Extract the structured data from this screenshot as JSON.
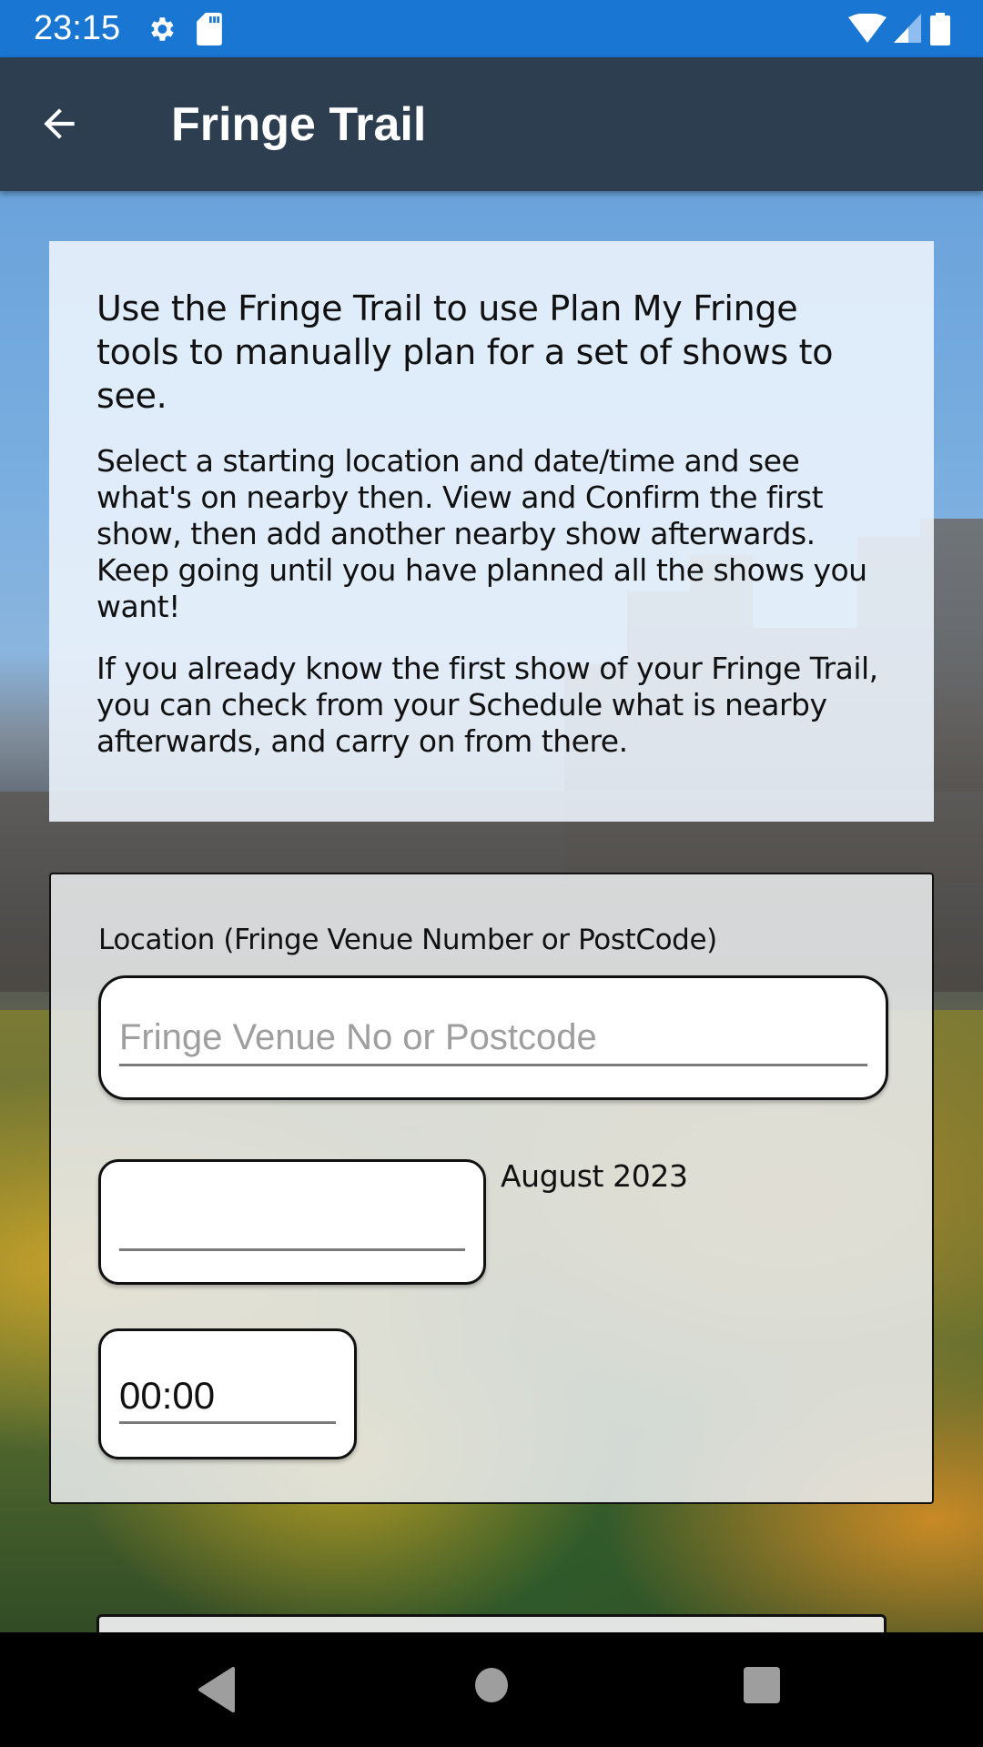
{
  "status_bar": {
    "time": "23:15",
    "left_icons": [
      "settings-icon",
      "sd-card-icon"
    ],
    "right_icons": [
      "wifi-icon",
      "cell-signal-icon",
      "battery-icon"
    ]
  },
  "app_bar": {
    "back_icon": "arrow-back-icon",
    "title": "Fringe Trail"
  },
  "intro": {
    "heading": "Use the Fringe Trail to use Plan My Fringe tools to manually plan for a set of shows to see.",
    "paragraph_1": "Select a starting location and date/time and see what's on nearby then. View and Confirm the first show, then add another nearby show afterwards. Keep going until you have planned all the shows you want!",
    "paragraph_2": "If you already know the first show of your Fringe Trail, you can check from your Schedule what is nearby afterwards, and carry on from there."
  },
  "form": {
    "location_label": "Location (Fringe Venue Number or PostCode)",
    "location_value": "",
    "location_placeholder": "Fringe Venue No or Postcode",
    "date_value": "",
    "month_label": "August 2023",
    "time_value": "00:00"
  },
  "nav_bar": {
    "back_icon": "nav-back-icon",
    "home_icon": "nav-home-icon",
    "recents_icon": "nav-recents-icon"
  }
}
